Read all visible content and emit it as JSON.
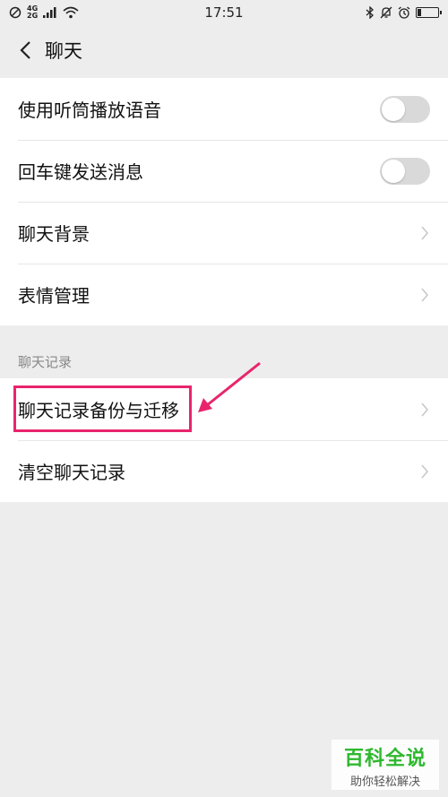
{
  "status_bar": {
    "network_top": "4G",
    "network_bottom": "2G",
    "time": "17:51"
  },
  "nav": {
    "title": "聊天"
  },
  "settings": {
    "items": [
      {
        "label": "使用听筒播放语音",
        "type": "toggle",
        "on": false
      },
      {
        "label": "回车键发送消息",
        "type": "toggle",
        "on": false
      },
      {
        "label": "聊天背景",
        "type": "link"
      },
      {
        "label": "表情管理",
        "type": "link"
      }
    ]
  },
  "chat_history": {
    "section_label": "聊天记录",
    "items": [
      {
        "label": "聊天记录备份与迁移",
        "type": "link"
      },
      {
        "label": "清空聊天记录",
        "type": "link"
      }
    ]
  },
  "watermark": {
    "main": "百科全说",
    "sub": "助你轻松解决"
  },
  "colors": {
    "highlight": "#e8256c",
    "watermark_green": "#2eb82e",
    "background": "#ededed",
    "toggle_off": "#d9d9d9"
  },
  "battery_level": 0.2
}
